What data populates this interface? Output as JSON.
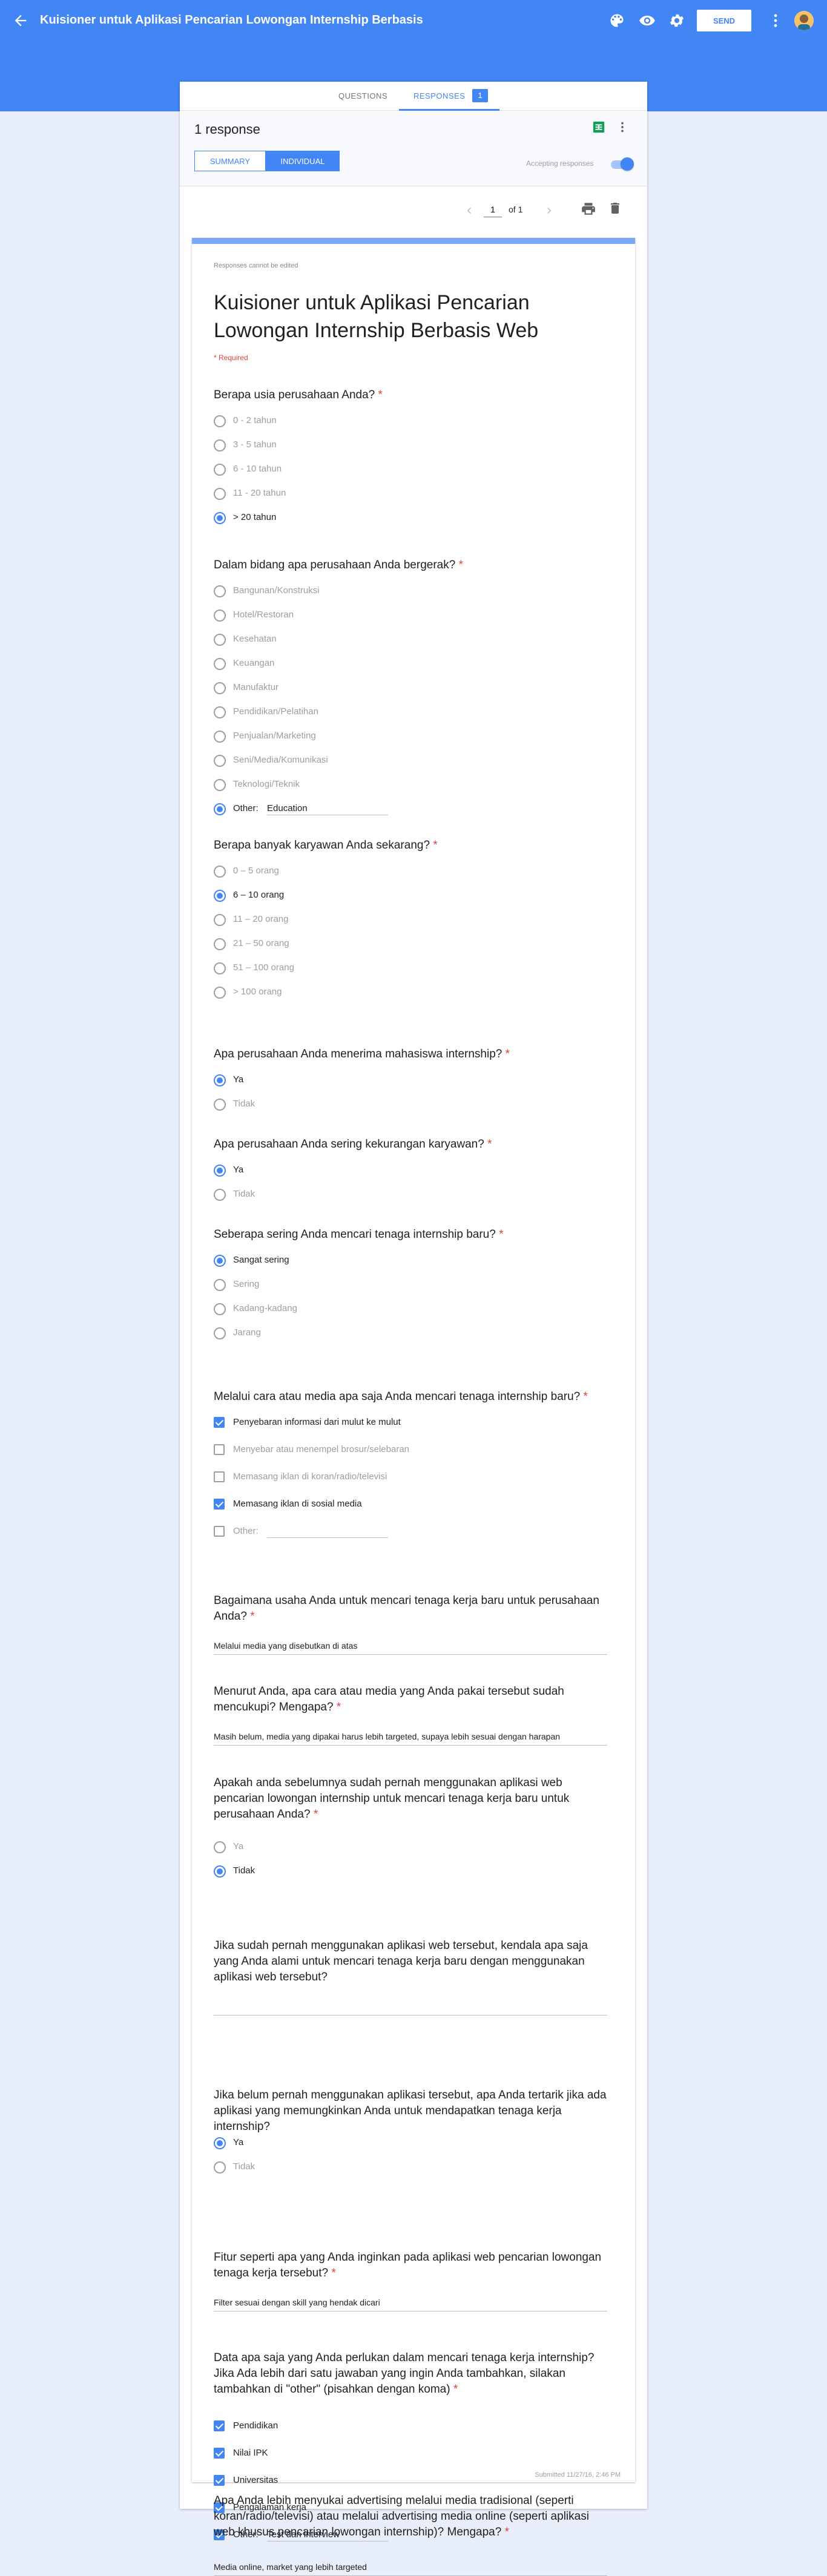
{
  "topbar": {
    "title": "Kuisioner untuk Aplikasi Pencarian Lowongan Internship Berbasis",
    "send_label": "SEND"
  },
  "tabs": {
    "questions": "QUESTIONS",
    "responses": "RESPONSES",
    "responses_count": "1"
  },
  "summary": {
    "response_count": "1 response",
    "summary_label": "SUMMARY",
    "individual_label": "INDIVIDUAL",
    "accepting_label": "Accepting responses"
  },
  "pager": {
    "page": "1",
    "of_label": "of 1"
  },
  "form": {
    "note": "Responses cannot be edited",
    "title": "Kuisioner untuk Aplikasi Pencarian Lowongan Internship Berbasis Web",
    "required_note": "* Required",
    "submitted": "Submitted 11/27/16, 2:46 PM"
  },
  "questions": [
    {
      "title": "Berapa usia perusahaan Anda?",
      "required": "*",
      "type": "radio",
      "options": [
        "0 - 2 tahun",
        "3 - 5 tahun",
        "6 - 10 tahun",
        "11 - 20 tahun",
        "> 20 tahun"
      ],
      "selected": 4
    },
    {
      "title": "Dalam bidang apa perusahaan Anda bergerak?",
      "required": "*",
      "type": "radio",
      "options": [
        "Bangunan/Konstruksi",
        "Hotel/Restoran",
        "Kesehatan",
        "Keuangan",
        "Manufaktur",
        "Pendidikan/Pelatihan",
        "Penjualan/Marketing",
        "Seni/Media/Komunikasi",
        "Teknologi/Teknik"
      ],
      "other_label": "Other:",
      "other_value": "Education",
      "selected": "other"
    },
    {
      "title": "Berapa banyak karyawan Anda sekarang?",
      "required": "*",
      "type": "radio",
      "options": [
        "0 – 5 orang",
        "6 – 10 orang",
        "11 – 20 orang",
        "21 – 50 orang",
        "51 – 100 orang",
        "> 100 orang"
      ],
      "selected": 1
    },
    {
      "title": "Apa perusahaan Anda menerima mahasiswa internship?",
      "required": "*",
      "type": "radio",
      "options": [
        "Ya",
        "Tidak"
      ],
      "selected": 0
    },
    {
      "title": "Apa perusahaan Anda sering kekurangan karyawan?",
      "required": "*",
      "type": "radio",
      "options": [
        "Ya",
        "Tidak"
      ],
      "selected": 0
    },
    {
      "title": "Seberapa sering Anda mencari tenaga internship baru?",
      "required": "*",
      "type": "radio",
      "options": [
        "Sangat sering",
        "Sering",
        "Kadang-kadang",
        "Jarang"
      ],
      "selected": 0
    },
    {
      "title": "Melalui cara atau media apa saja Anda mencari tenaga internship baru?",
      "required": "*",
      "type": "checkbox",
      "options": [
        "Penyebaran informasi dari mulut ke mulut",
        "Menyebar atau menempel brosur/selebaran",
        "Memasang iklan di koran/radio/televisi",
        "Memasang iklan di sosial media"
      ],
      "checked": [
        true,
        false,
        false,
        true
      ],
      "other_label": "Other:",
      "other_value": "",
      "other_checked": false
    },
    {
      "title": "Bagaimana usaha Anda untuk mencari tenaga kerja baru untuk perusahaan Anda?",
      "required": "*",
      "type": "text",
      "answer": "Melalui media yang disebutkan di atas"
    },
    {
      "title": "Menurut Anda, apa cara atau media yang Anda pakai tersebut sudah mencukupi? Mengapa?",
      "required": "*",
      "type": "text",
      "answer": "Masih belum, media yang dipakai harus lebih targeted, supaya lebih sesuai dengan harapan"
    },
    {
      "title": "Apakah anda sebelumnya sudah pernah menggunakan aplikasi web pencarian lowongan internship untuk mencari tenaga kerja baru untuk perusahaan Anda?",
      "required": "*",
      "type": "radio",
      "options": [
        "Ya",
        "Tidak"
      ],
      "selected": 1
    },
    {
      "title": "Jika sudah pernah menggunakan aplikasi web tersebut, kendala apa saja yang Anda alami untuk mencari tenaga kerja baru dengan menggunakan aplikasi web tersebut?",
      "required": "",
      "type": "text",
      "answer": ""
    },
    {
      "title": "Jika belum pernah menggunakan aplikasi tersebut, apa Anda tertarik jika ada aplikasi yang memungkinkan Anda untuk mendapatkan tenaga kerja internship?",
      "required": "",
      "type": "radio",
      "options": [
        "Ya",
        "Tidak"
      ],
      "selected": 0
    },
    {
      "title": "Fitur seperti apa yang Anda inginkan pada aplikasi web pencarian lowongan tenaga kerja tersebut?",
      "required": "*",
      "type": "text",
      "answer": "Filter sesuai dengan skill yang hendak dicari"
    },
    {
      "title": "Data apa saja yang Anda perlukan dalam mencari tenaga kerja internship? Jika Ada lebih dari satu jawaban yang ingin Anda tambahkan, silakan tambahkan di \"other\" (pisahkan dengan koma)",
      "required": "*",
      "type": "checkbox",
      "options": [
        "Pendidikan",
        "Nilai IPK",
        "Universitas",
        "Pengalaman kerja"
      ],
      "checked": [
        true,
        true,
        true,
        true
      ],
      "other_label": "Other:",
      "other_value": "Test dan interview",
      "other_checked": true
    },
    {
      "title": "Apa Anda lebih menyukai advertising melalui media tradisional (seperti koran/radio/televisi) atau melalui advertising media online (seperti aplikasi web khusus pencarian lowongan internship)? Mengapa?",
      "required": "*",
      "type": "text",
      "answer": "Media online, market yang lebih targeted"
    }
  ],
  "colors": {
    "accent": "#4285f4",
    "required": "#db4437",
    "background": "#e8eefa"
  }
}
